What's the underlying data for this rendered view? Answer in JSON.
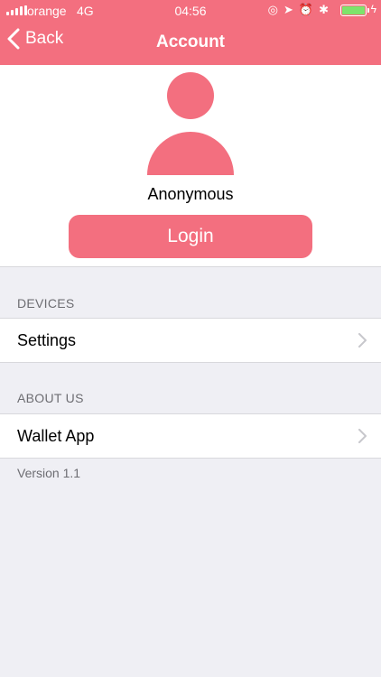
{
  "status_bar": {
    "carrier": "orange",
    "network": "4G",
    "time": "04:56",
    "battery_level": 1.0
  },
  "nav": {
    "back_label": "Back",
    "title": "Account"
  },
  "profile": {
    "username": "Anonymous",
    "login_label": "Login"
  },
  "sections": {
    "devices": {
      "header": "DEVICES",
      "item_label": "Settings"
    },
    "about": {
      "header": "ABOUT US",
      "item_label": "Wallet App"
    }
  },
  "footer": {
    "version": "Version 1.1"
  },
  "colors": {
    "accent": "#f36f7f",
    "background": "#efeff4",
    "battery": "#7ee36b",
    "secondary_text": "#6d6d72"
  },
  "icons": [
    "signal-icon",
    "location-target-icon",
    "location-arrow-icon",
    "alarm-icon",
    "bluetooth-icon",
    "battery-icon",
    "charging-icon",
    "back-chevron-icon",
    "chevron-right-icon",
    "user-avatar-icon"
  ]
}
